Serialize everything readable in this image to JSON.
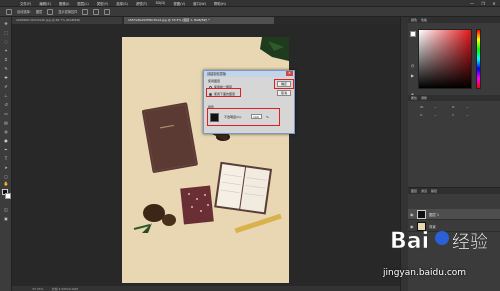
{
  "menu": {
    "items": [
      "文件(F)",
      "编辑(E)",
      "图像(I)",
      "图层(L)",
      "类型(Y)",
      "选择(S)",
      "滤镜(T)",
      "3D(D)",
      "视图(V)",
      "窗口(W)",
      "帮助(H)"
    ],
    "window_controls": [
      "—",
      "❐",
      "✕"
    ]
  },
  "options_bar": {
    "tool_text": "自动选择:",
    "mode_value": "图层",
    "transform_label": "显示变换控件"
  },
  "document_tabs": [
    {
      "label": "4a5b9f0c1b3c0e2b.jpg @ 66.7% (RGB/8#)",
      "active": false
    },
    {
      "label": "1657e3bd0d5f6c3b1d.jpg @ 33.3% (图层 1, RGB/8#) *",
      "active": true
    }
  ],
  "status_bar": {
    "zoom": "33.33%",
    "doc_info": "文档:4.50M/9.00M"
  },
  "dialog": {
    "title": "创建剪贴蒙版",
    "close_glyph": "✕",
    "section_label": "使用图层",
    "option_previous": "使用前一图层",
    "option_below": "使用下面的图层",
    "ok_label": "确定",
    "cancel_label": "取消",
    "color_section_label": "颜色",
    "opacity_label": "不透明度(O):",
    "opacity_value": "100",
    "opacity_unit": "%",
    "selected_option": "option_below",
    "swatch_color": "#111111"
  },
  "panels": {
    "color_tabs": [
      "颜色",
      "色板"
    ],
    "adjust_tabs": [
      "属性",
      "调整"
    ],
    "props": [
      {
        "label": "W:",
        "value": "—"
      },
      {
        "label": "H:",
        "value": "—"
      },
      {
        "label": "X:",
        "value": "—"
      },
      {
        "label": "Y:",
        "value": "—"
      }
    ],
    "layer_tabs": [
      "图层",
      "通道",
      "路径"
    ],
    "layers": [
      {
        "name": "图层 1",
        "thumb": "black",
        "selected": true
      },
      {
        "name": "背景",
        "thumb": "photo",
        "selected": false
      }
    ]
  },
  "watermark": {
    "logo_text": "Bai 经验",
    "url": "jingyan.baidu.com"
  },
  "colors": {
    "highlight_red": "#e02020",
    "dialog_title_bar": "#c3d3ea",
    "photo_background": "#e8d6b2"
  }
}
